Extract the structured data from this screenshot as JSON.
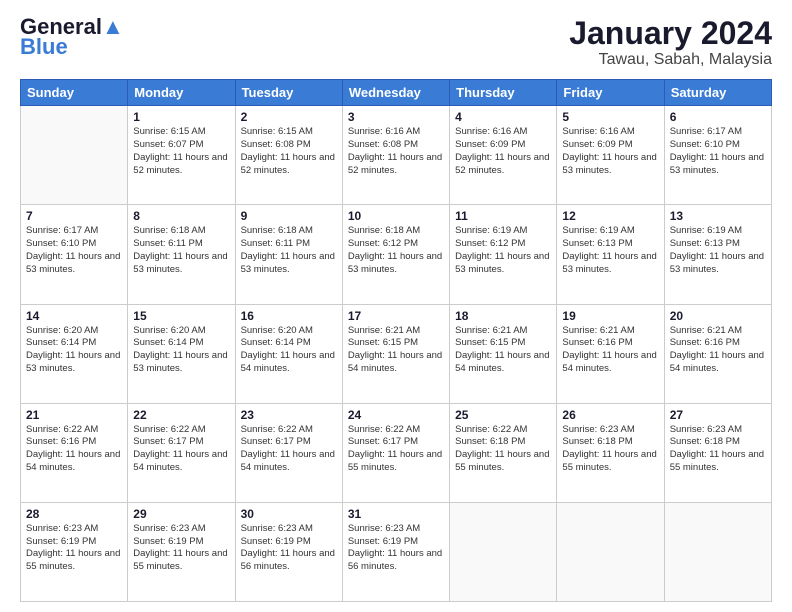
{
  "logo": {
    "line1": "General",
    "line2": "Blue"
  },
  "title": "January 2024",
  "subtitle": "Tawau, Sabah, Malaysia",
  "days_of_week": [
    "Sunday",
    "Monday",
    "Tuesday",
    "Wednesday",
    "Thursday",
    "Friday",
    "Saturday"
  ],
  "weeks": [
    [
      {
        "day": "",
        "info": ""
      },
      {
        "day": "1",
        "info": "Sunrise: 6:15 AM\nSunset: 6:07 PM\nDaylight: 11 hours\nand 52 minutes."
      },
      {
        "day": "2",
        "info": "Sunrise: 6:15 AM\nSunset: 6:08 PM\nDaylight: 11 hours\nand 52 minutes."
      },
      {
        "day": "3",
        "info": "Sunrise: 6:16 AM\nSunset: 6:08 PM\nDaylight: 11 hours\nand 52 minutes."
      },
      {
        "day": "4",
        "info": "Sunrise: 6:16 AM\nSunset: 6:09 PM\nDaylight: 11 hours\nand 52 minutes."
      },
      {
        "day": "5",
        "info": "Sunrise: 6:16 AM\nSunset: 6:09 PM\nDaylight: 11 hours\nand 53 minutes."
      },
      {
        "day": "6",
        "info": "Sunrise: 6:17 AM\nSunset: 6:10 PM\nDaylight: 11 hours\nand 53 minutes."
      }
    ],
    [
      {
        "day": "7",
        "info": "Sunrise: 6:17 AM\nSunset: 6:10 PM\nDaylight: 11 hours\nand 53 minutes."
      },
      {
        "day": "8",
        "info": "Sunrise: 6:18 AM\nSunset: 6:11 PM\nDaylight: 11 hours\nand 53 minutes."
      },
      {
        "day": "9",
        "info": "Sunrise: 6:18 AM\nSunset: 6:11 PM\nDaylight: 11 hours\nand 53 minutes."
      },
      {
        "day": "10",
        "info": "Sunrise: 6:18 AM\nSunset: 6:12 PM\nDaylight: 11 hours\nand 53 minutes."
      },
      {
        "day": "11",
        "info": "Sunrise: 6:19 AM\nSunset: 6:12 PM\nDaylight: 11 hours\nand 53 minutes."
      },
      {
        "day": "12",
        "info": "Sunrise: 6:19 AM\nSunset: 6:13 PM\nDaylight: 11 hours\nand 53 minutes."
      },
      {
        "day": "13",
        "info": "Sunrise: 6:19 AM\nSunset: 6:13 PM\nDaylight: 11 hours\nand 53 minutes."
      }
    ],
    [
      {
        "day": "14",
        "info": "Sunrise: 6:20 AM\nSunset: 6:14 PM\nDaylight: 11 hours\nand 53 minutes."
      },
      {
        "day": "15",
        "info": "Sunrise: 6:20 AM\nSunset: 6:14 PM\nDaylight: 11 hours\nand 53 minutes."
      },
      {
        "day": "16",
        "info": "Sunrise: 6:20 AM\nSunset: 6:14 PM\nDaylight: 11 hours\nand 54 minutes."
      },
      {
        "day": "17",
        "info": "Sunrise: 6:21 AM\nSunset: 6:15 PM\nDaylight: 11 hours\nand 54 minutes."
      },
      {
        "day": "18",
        "info": "Sunrise: 6:21 AM\nSunset: 6:15 PM\nDaylight: 11 hours\nand 54 minutes."
      },
      {
        "day": "19",
        "info": "Sunrise: 6:21 AM\nSunset: 6:16 PM\nDaylight: 11 hours\nand 54 minutes."
      },
      {
        "day": "20",
        "info": "Sunrise: 6:21 AM\nSunset: 6:16 PM\nDaylight: 11 hours\nand 54 minutes."
      }
    ],
    [
      {
        "day": "21",
        "info": "Sunrise: 6:22 AM\nSunset: 6:16 PM\nDaylight: 11 hours\nand 54 minutes."
      },
      {
        "day": "22",
        "info": "Sunrise: 6:22 AM\nSunset: 6:17 PM\nDaylight: 11 hours\nand 54 minutes."
      },
      {
        "day": "23",
        "info": "Sunrise: 6:22 AM\nSunset: 6:17 PM\nDaylight: 11 hours\nand 54 minutes."
      },
      {
        "day": "24",
        "info": "Sunrise: 6:22 AM\nSunset: 6:17 PM\nDaylight: 11 hours\nand 55 minutes."
      },
      {
        "day": "25",
        "info": "Sunrise: 6:22 AM\nSunset: 6:18 PM\nDaylight: 11 hours\nand 55 minutes."
      },
      {
        "day": "26",
        "info": "Sunrise: 6:23 AM\nSunset: 6:18 PM\nDaylight: 11 hours\nand 55 minutes."
      },
      {
        "day": "27",
        "info": "Sunrise: 6:23 AM\nSunset: 6:18 PM\nDaylight: 11 hours\nand 55 minutes."
      }
    ],
    [
      {
        "day": "28",
        "info": "Sunrise: 6:23 AM\nSunset: 6:19 PM\nDaylight: 11 hours\nand 55 minutes."
      },
      {
        "day": "29",
        "info": "Sunrise: 6:23 AM\nSunset: 6:19 PM\nDaylight: 11 hours\nand 55 minutes."
      },
      {
        "day": "30",
        "info": "Sunrise: 6:23 AM\nSunset: 6:19 PM\nDaylight: 11 hours\nand 56 minutes."
      },
      {
        "day": "31",
        "info": "Sunrise: 6:23 AM\nSunset: 6:19 PM\nDaylight: 11 hours\nand 56 minutes."
      },
      {
        "day": "",
        "info": ""
      },
      {
        "day": "",
        "info": ""
      },
      {
        "day": "",
        "info": ""
      }
    ]
  ]
}
